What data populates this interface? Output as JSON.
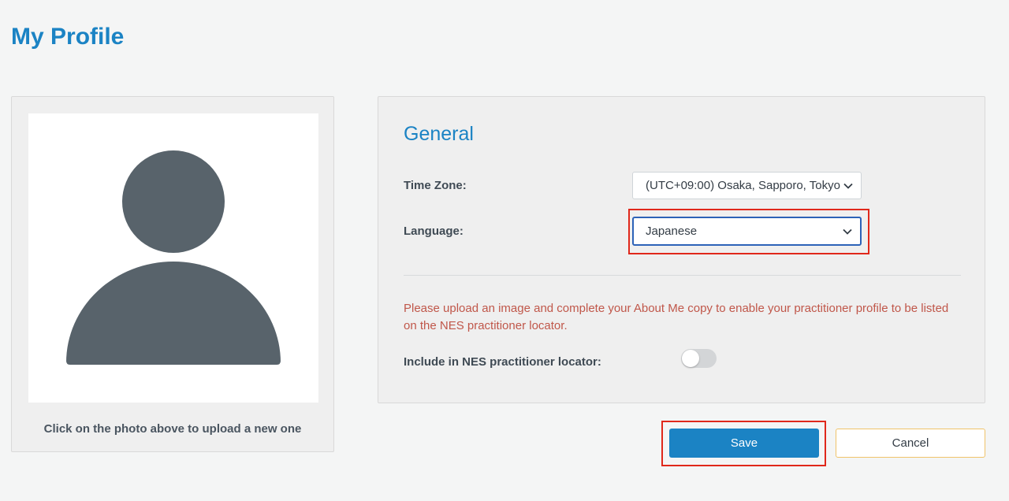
{
  "page": {
    "title": "My Profile"
  },
  "photo": {
    "caption": "Click on the photo above to upload a new one",
    "icon": "user-avatar-placeholder-icon"
  },
  "general": {
    "title": "General",
    "time_zone": {
      "label": "Time Zone:",
      "value": "(UTC+09:00) Osaka, Sapporo, Tokyo"
    },
    "language": {
      "label": "Language:",
      "value": "Japanese"
    },
    "warning": "Please upload an image and complete your About Me copy to enable your practitioner profile to be listed on the NES practitioner locator.",
    "locator": {
      "label": "Include in NES practitioner locator:",
      "enabled": false
    }
  },
  "actions": {
    "save_label": "Save",
    "cancel_label": "Cancel"
  },
  "colors": {
    "accent": "#1b83c4",
    "warning_text": "#c0574a",
    "avatar": "#58636b",
    "highlight": "#e0281b",
    "cancel_border": "#f0c36a"
  }
}
